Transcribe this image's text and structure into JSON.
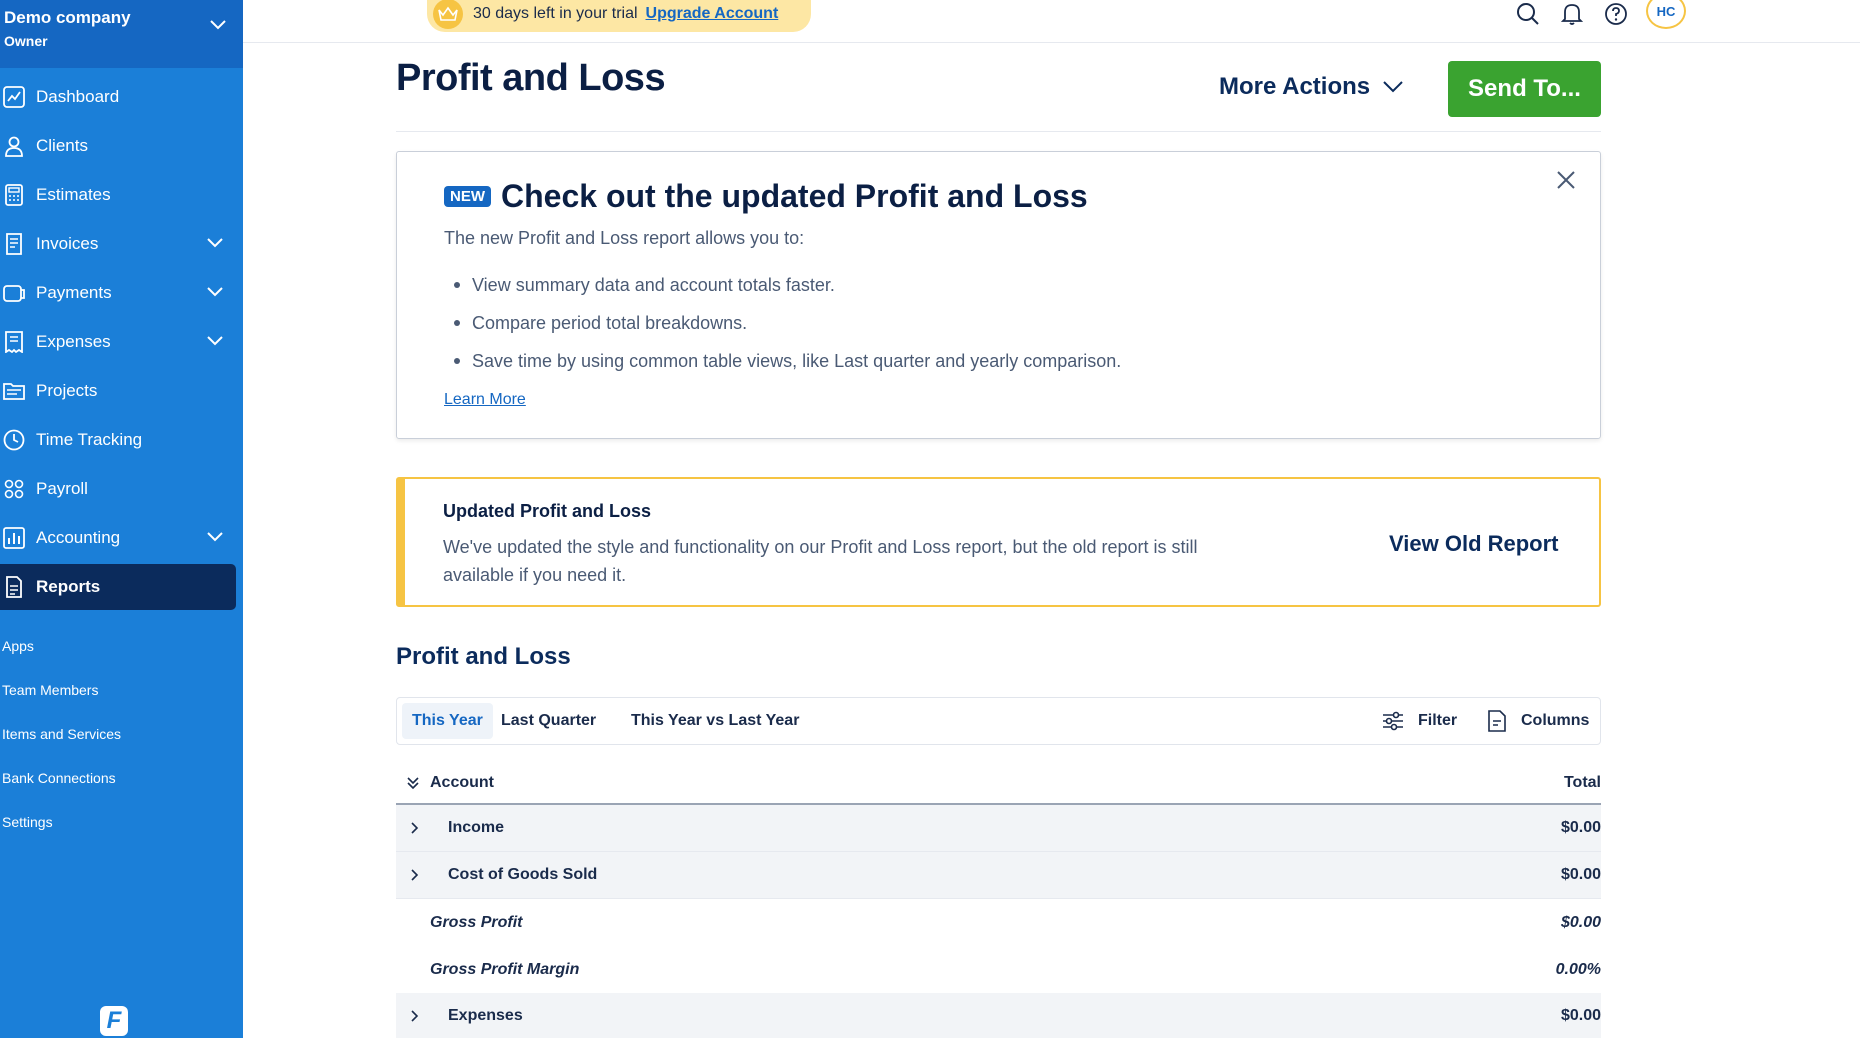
{
  "sidebar": {
    "company_name": "Demo company",
    "role": "Owner",
    "nav": [
      {
        "label": "Dashboard",
        "icon": "chart-line-icon",
        "expandable": false
      },
      {
        "label": "Clients",
        "icon": "user-icon",
        "expandable": false
      },
      {
        "label": "Estimates",
        "icon": "calculator-icon",
        "expandable": false
      },
      {
        "label": "Invoices",
        "icon": "invoice-icon",
        "expandable": true
      },
      {
        "label": "Payments",
        "icon": "payment-icon",
        "expandable": true
      },
      {
        "label": "Expenses",
        "icon": "receipt-icon",
        "expandable": true
      },
      {
        "label": "Projects",
        "icon": "folder-icon",
        "expandable": false
      },
      {
        "label": "Time Tracking",
        "icon": "clock-icon",
        "expandable": false
      },
      {
        "label": "Payroll",
        "icon": "people-icon",
        "expandable": false
      },
      {
        "label": "Accounting",
        "icon": "bar-chart-icon",
        "expandable": true
      },
      {
        "label": "Reports",
        "icon": "report-icon",
        "expandable": false,
        "active": true
      }
    ],
    "secondary": [
      "Apps",
      "Team Members",
      "Items and Services",
      "Bank Connections",
      "Settings"
    ],
    "logo_letter": "F"
  },
  "topbar": {
    "trial_text": "30 days left in your trial",
    "upgrade_link": "Upgrade Account",
    "avatar_initials": "HC"
  },
  "page": {
    "title": "Profit and Loss",
    "more_actions": "More Actions",
    "send_to": "Send To..."
  },
  "promo": {
    "badge": "NEW",
    "heading": "Check out the updated Profit and Loss",
    "intro": "The new Profit and Loss report allows you to:",
    "bullets": [
      "View summary data and account totals faster.",
      "Compare period total breakdowns.",
      "Save time by using common table views, like Last quarter and yearly comparison."
    ],
    "learn_more": "Learn More"
  },
  "notice": {
    "title": "Updated Profit and Loss",
    "body": "We've updated the style and functionality on our Profit and Loss report, but the old report is still available if you need it.",
    "action": "View Old Report"
  },
  "report": {
    "section_title": "Profit and Loss",
    "tabs": [
      "This Year",
      "Last Quarter",
      "This Year vs Last Year"
    ],
    "filter": "Filter",
    "columns": "Columns",
    "header_account": "Account",
    "header_total": "Total",
    "rows": [
      {
        "label": "Income",
        "value": "$0.00",
        "type": "group"
      },
      {
        "label": "Cost of Goods Sold",
        "value": "$0.00",
        "type": "group"
      },
      {
        "label": "Gross Profit",
        "value": "$0.00",
        "type": "calc"
      },
      {
        "label": "Gross Profit Margin",
        "value": "0.00%",
        "type": "calc"
      },
      {
        "label": "Expenses",
        "value": "$0.00",
        "type": "group"
      }
    ]
  },
  "colors": {
    "sidebar_bg": "#1b7fd8",
    "sidebar_active": "#0b2b5c",
    "primary_green": "#3aa330",
    "accent_yellow": "#f6c443",
    "link_blue": "#1567c2"
  }
}
